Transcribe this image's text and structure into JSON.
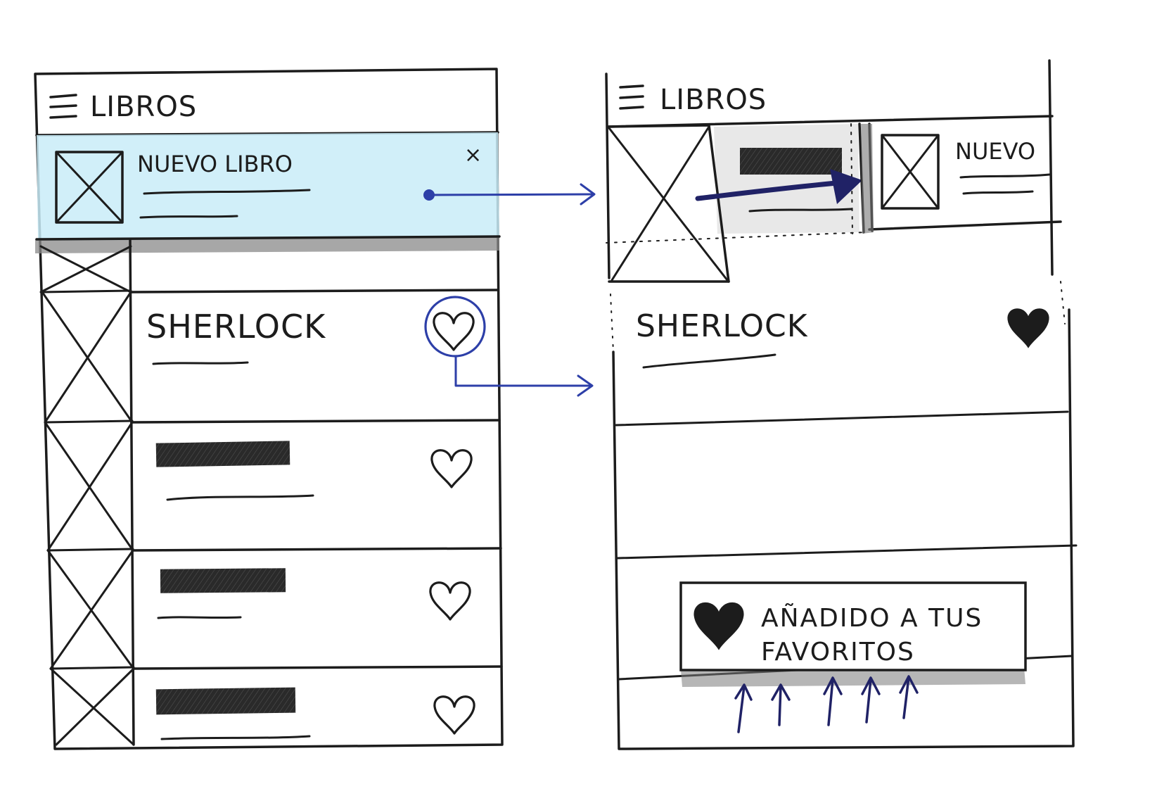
{
  "left_screen": {
    "app_title": "LIBROS",
    "menu_icon": "hamburger-menu-icon",
    "new_book_banner": {
      "title": "NUEVO LIBRO",
      "close_label": "×",
      "highlight_color": "#c9ecf8"
    },
    "book_rows": [
      {
        "title": "SHERLOCK",
        "favorite": false,
        "highlighted": true
      },
      {
        "title": "",
        "favorite": false
      },
      {
        "title": "",
        "favorite": false
      },
      {
        "title": "",
        "favorite": false
      }
    ]
  },
  "right_screen": {
    "app_title": "LIBROS",
    "menu_icon": "hamburger-menu-icon",
    "sliding_card_title": "NUEVO",
    "book_row": {
      "title": "SHERLOCK",
      "favorite": true
    },
    "toast": {
      "line1": "AÑADIDO A TUS",
      "line2": "FAVORITOS",
      "icon": "filled-heart-icon"
    }
  },
  "colors": {
    "ink": "#1c1c1c",
    "annotation_blue": "#2d3fa8",
    "arrow_navy": "#202266",
    "banner_highlight": "#c9ecf8"
  }
}
